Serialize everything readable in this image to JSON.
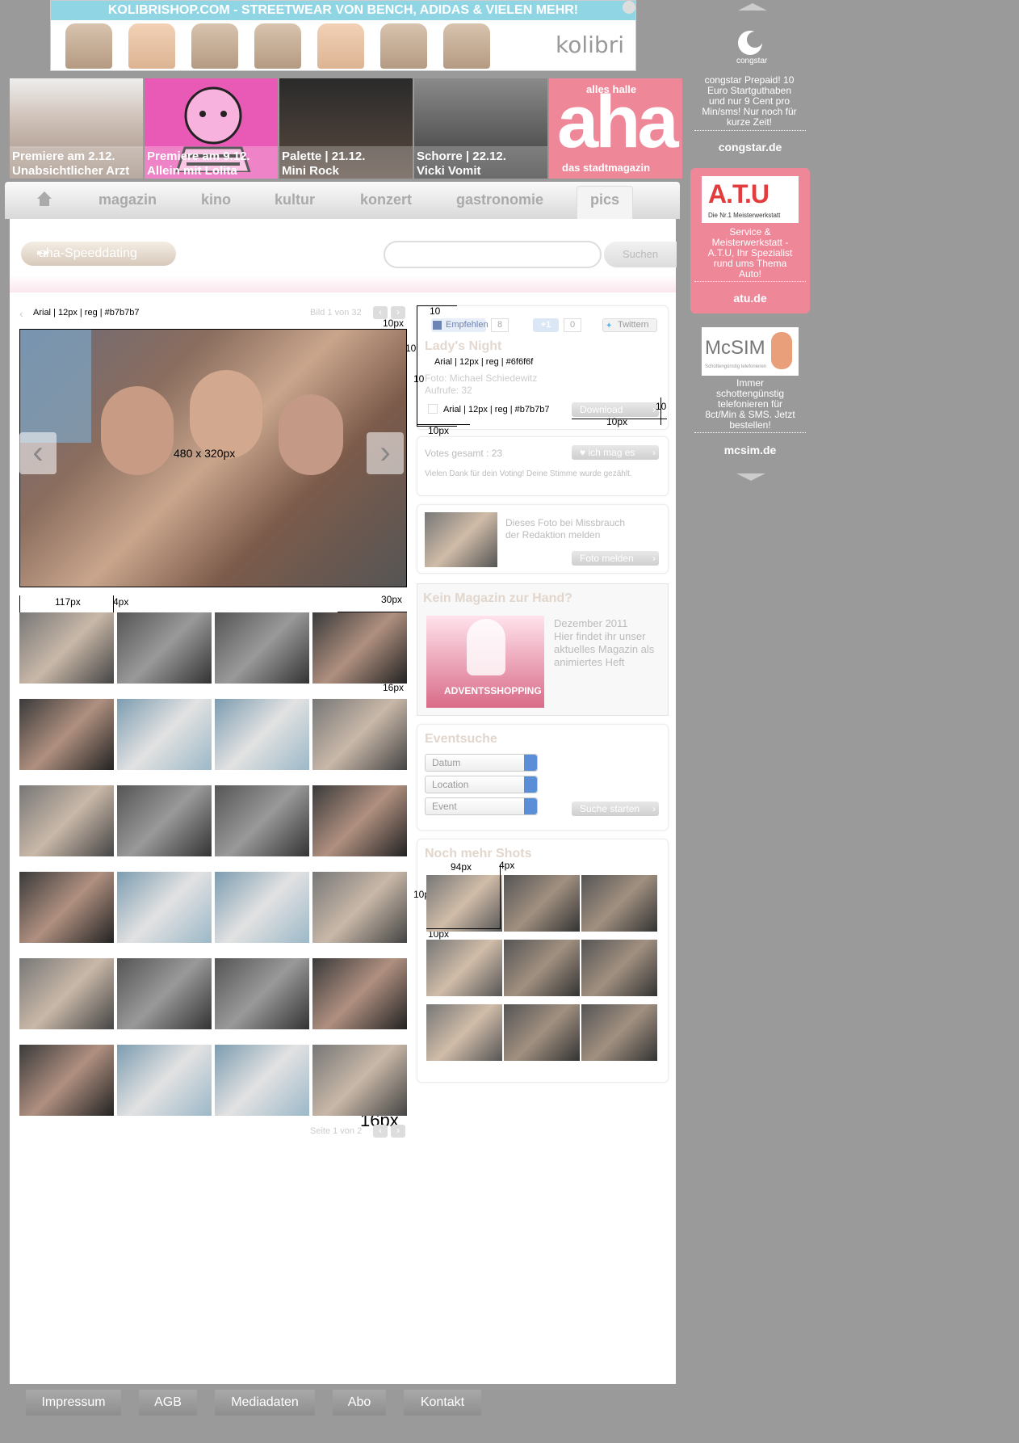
{
  "banner": {
    "headline": "KOLIBRISHOP.COM - STREETWEAR VON BENCH, ADIDAS & VIELEN MEHR!",
    "logo": "kolibri"
  },
  "teasers": [
    {
      "line1": "Premiere am 2.12.",
      "line2": "Unabsichtlicher Arzt"
    },
    {
      "line1": "Premiere am 9.12.",
      "line2": "Allein mit Lolita"
    },
    {
      "line1": "Palette | 21.12.",
      "line2": "Mini Rock"
    },
    {
      "line1": "Schorre | 22.12.",
      "line2": "Vicki Vomit"
    }
  ],
  "aha": {
    "tag": "alles halle",
    "logo": "aha",
    "sub": "das stadtmagazin"
  },
  "nav": {
    "items": [
      "magazin",
      "kino",
      "kultur",
      "konzert",
      "gastronomie",
      "pics"
    ]
  },
  "speeddating": "aha-Speeddating",
  "search": {
    "button": "Suchen"
  },
  "spec": {
    "arial_b7": "Arial | 12px | reg | #b7b7b7",
    "arial_6f": "Arial | 12px | reg | #6f6f6f",
    "photo_size": "480 x 320px",
    "m10": "10",
    "m10px": "10px",
    "m117": "117px",
    "m4": "4px",
    "m30": "30px",
    "m16": "16px",
    "m94": "94px"
  },
  "gallery": {
    "counter": "Bild 1 von 32",
    "pager": "Seite 1 von 2"
  },
  "details": {
    "fb_label": "Empfehlen",
    "fb_count": "8",
    "gplus_label": "+1",
    "gplus_count": "0",
    "twitter_label": "Twittern",
    "title": "Lady's Night",
    "photo_credit": "Foto: Michael Schiedewitz",
    "views": "Aufrufe: 32",
    "download": "Download"
  },
  "votes": {
    "total": "Votes gesamt : 23",
    "like": "ich mag es",
    "thanks": "Vielen Dank für dein Voting! Deine Stimme wurde gezählt."
  },
  "report": {
    "text1": "Dieses Foto bei Missbrauch",
    "text2": "der Redaktion melden",
    "button": "Foto melden"
  },
  "magazine": {
    "heading": "Kein Magazin zur Hand?",
    "issue": "Dezember 2011",
    "text": "Hier findet ihr unser aktuelles Magazin als animiertes Heft",
    "cover_title": "ADVENTSSHOPPING"
  },
  "eventsearch": {
    "heading": "Eventsuche",
    "selects": [
      "Datum",
      "Location",
      "Event"
    ],
    "button": "Suche starten"
  },
  "moreshots": {
    "heading": "Noch mehr Shots"
  },
  "ads": [
    {
      "brand": "congstar",
      "text": "congstar Prepaid! 10 Euro Startguthaben und nur 9 Cent pro Min/sms! Nur noch für kurze Zeit!",
      "link": "congstar.de"
    },
    {
      "brand": "A.T.U",
      "tagline": "Die Nr.1 Meisterwerkstatt",
      "text": "Service & Meisterwerkstatt - A.T.U, Ihr Spezialist rund ums Thema Auto!",
      "link": "atu.de"
    },
    {
      "brand": "McSIM",
      "tagline": "Schottengünstig telefonieren",
      "text": "Immer schottengünstig telefonieren für 8ct/Min & SMS. Jetzt bestellen!",
      "link": "mcsim.de"
    }
  ],
  "footer": [
    "Impressum",
    "AGB",
    "Mediadaten",
    "Abo",
    "Kontakt"
  ],
  "colors": {
    "bg": "#9a9a9a",
    "pink": "#ee8899",
    "cyan": "#8fd5e4",
    "text_grey": "#b7b7b7",
    "text_dark": "#6f6f6f"
  }
}
